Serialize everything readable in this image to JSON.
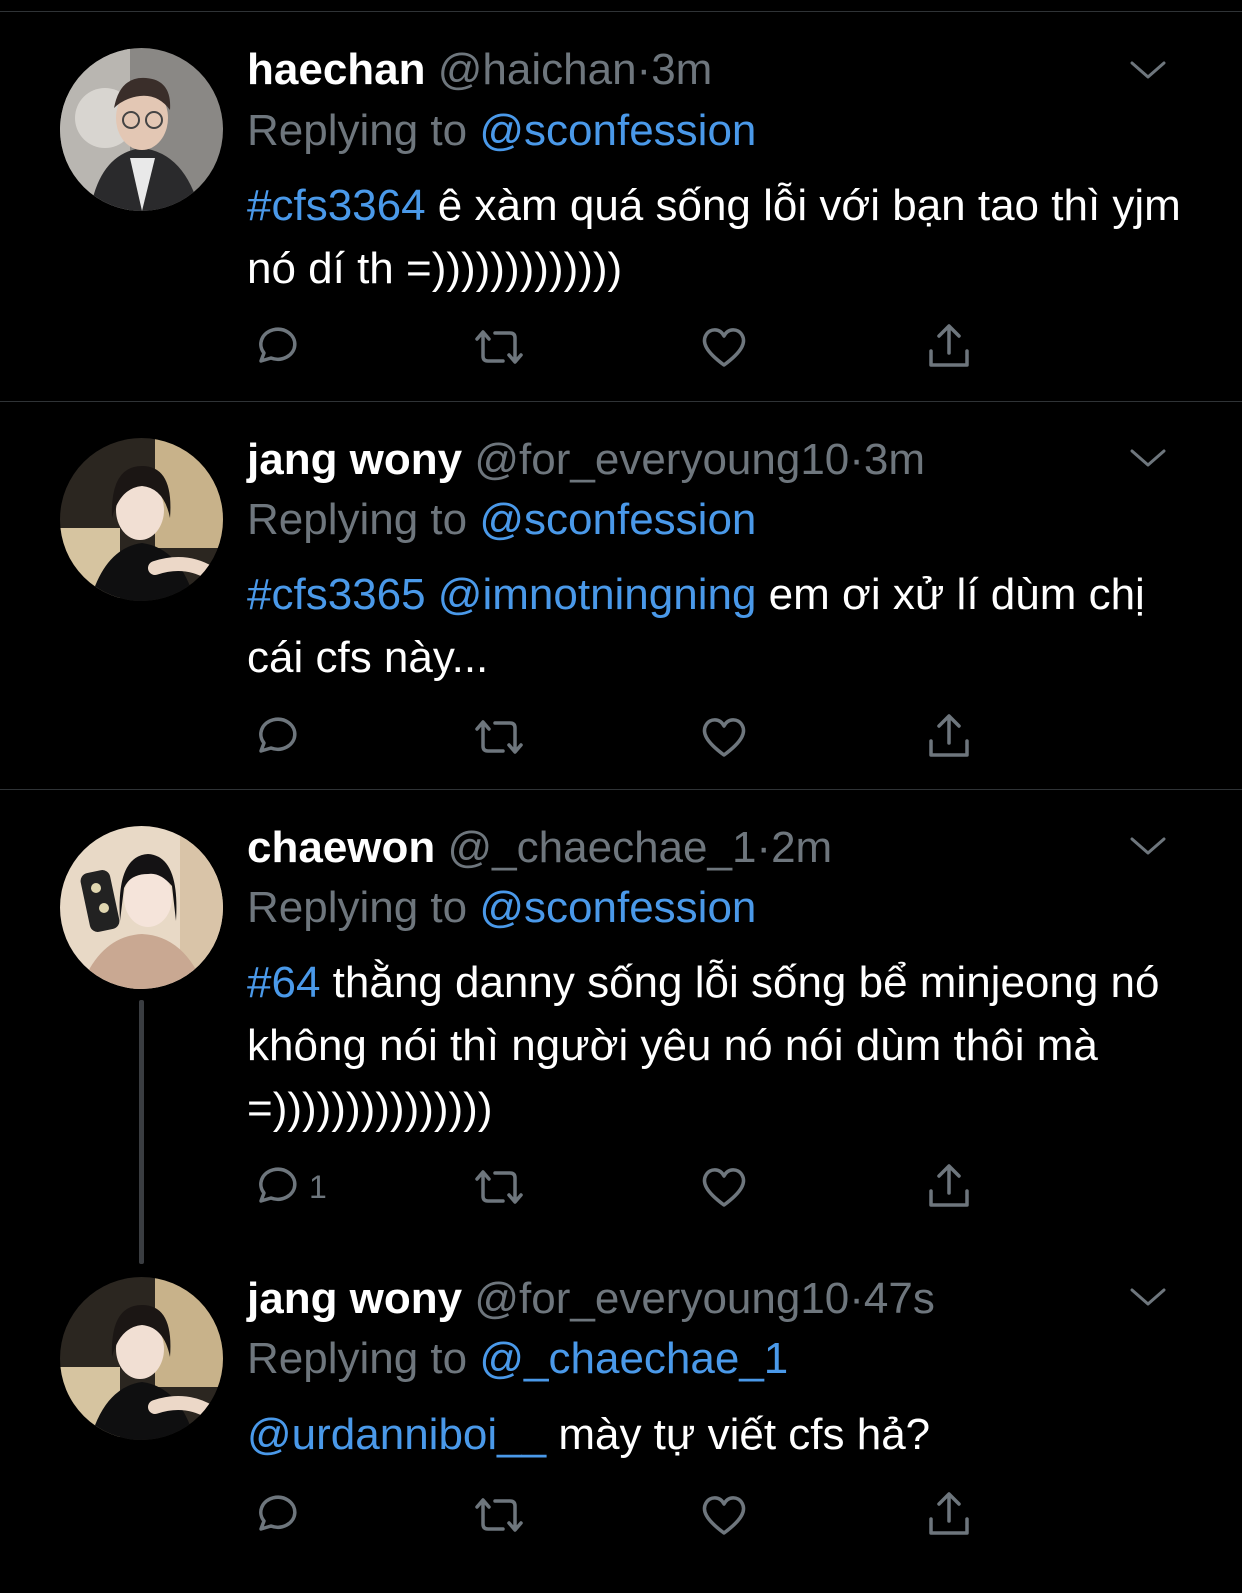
{
  "colors": {
    "background": "#000000",
    "link": "#4a99e9",
    "muted": "#6e767d",
    "divider": "#2f3336"
  },
  "icons": {
    "menu": "chevron-down-icon",
    "reply": "reply-icon",
    "retweet": "retweet-icon",
    "like": "heart-icon",
    "share": "share-icon"
  },
  "tweets": [
    {
      "name": "haechan",
      "handle": "@haichan",
      "dot": "·",
      "time": "3m",
      "replying_prefix": "Replying to",
      "replying_to": "@sconfession",
      "body": {
        "tag": "#cfs3364",
        "mention": "",
        "text": " ê xàm quá sống lỗi với bạn tao thì yjm nó dí th =)))))))))))))"
      },
      "reply_count": ""
    },
    {
      "name": "jang wony",
      "handle": "@for_everyoung10",
      "dot": "·",
      "time": "3m",
      "replying_prefix": "Replying to",
      "replying_to": "@sconfession",
      "body": {
        "tag": "#cfs3365",
        "mention": " @imnotningning",
        "text": " em ơi xử lí dùm chị cái cfs này..."
      },
      "reply_count": ""
    },
    {
      "name": "chaewon",
      "handle": "@_chaechae_1",
      "dot": "·",
      "time": "2m",
      "replying_prefix": "Replying to",
      "replying_to": "@sconfession",
      "body": {
        "tag": "#64",
        "mention": "",
        "text": " thằng danny sống lỗi sống bể minjeong nó không nói thì người yêu nó nói dùm thôi mà =)))))))))))))))"
      },
      "reply_count": "1"
    },
    {
      "name": "jang wony",
      "handle": "@for_everyoung10",
      "dot": "·",
      "time": "47s",
      "replying_prefix": "Replying to",
      "replying_to": "@_chaechae_1",
      "body": {
        "tag": "",
        "mention": "@urdanniboi__",
        "text": " mày tự viết cfs hả?"
      },
      "reply_count": ""
    }
  ]
}
